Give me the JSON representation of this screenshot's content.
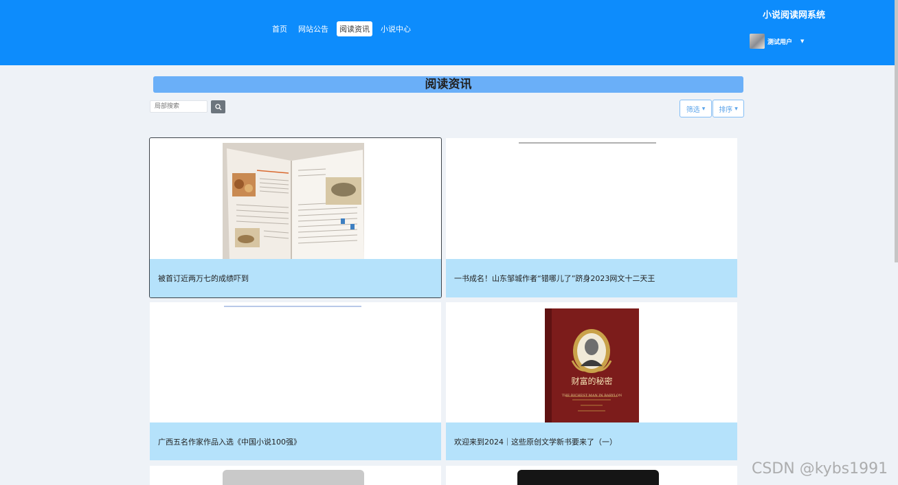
{
  "header": {
    "system_title": "小说阅读网系统",
    "nav": [
      "首页",
      "网站公告",
      "阅读资讯",
      "小说中心"
    ],
    "active_nav": "阅读资讯",
    "user_name": "测试用户"
  },
  "page": {
    "title": "阅读资讯",
    "search_placeholder": "局部搜索",
    "filter_label": "筛选",
    "sort_label": "排序"
  },
  "articles": [
    {
      "title": "被首订近两万七的成绩吓到",
      "image": "open-magazine"
    },
    {
      "title": "一书成名！山东邹城作者“错哪儿了”跻身2023网文十二天王",
      "image": "blank"
    },
    {
      "title": "广西五名作家作品入选《中国小说100强》",
      "image": "blank"
    },
    {
      "title": "欢迎来到2024｜这些原创文学新书要来了（一）",
      "image": "book-cover"
    }
  ],
  "book_cover": {
    "title": "财富的秘密",
    "subtitle_en": "THE RICHEST MAN IN BABYLON",
    "color": "#7c1c1b"
  },
  "watermark": "CSDN @kybs1991",
  "colors": {
    "primary": "#0d8cfc",
    "title_bar": "#6aaff8",
    "card_caption": "#b5e2fb"
  }
}
